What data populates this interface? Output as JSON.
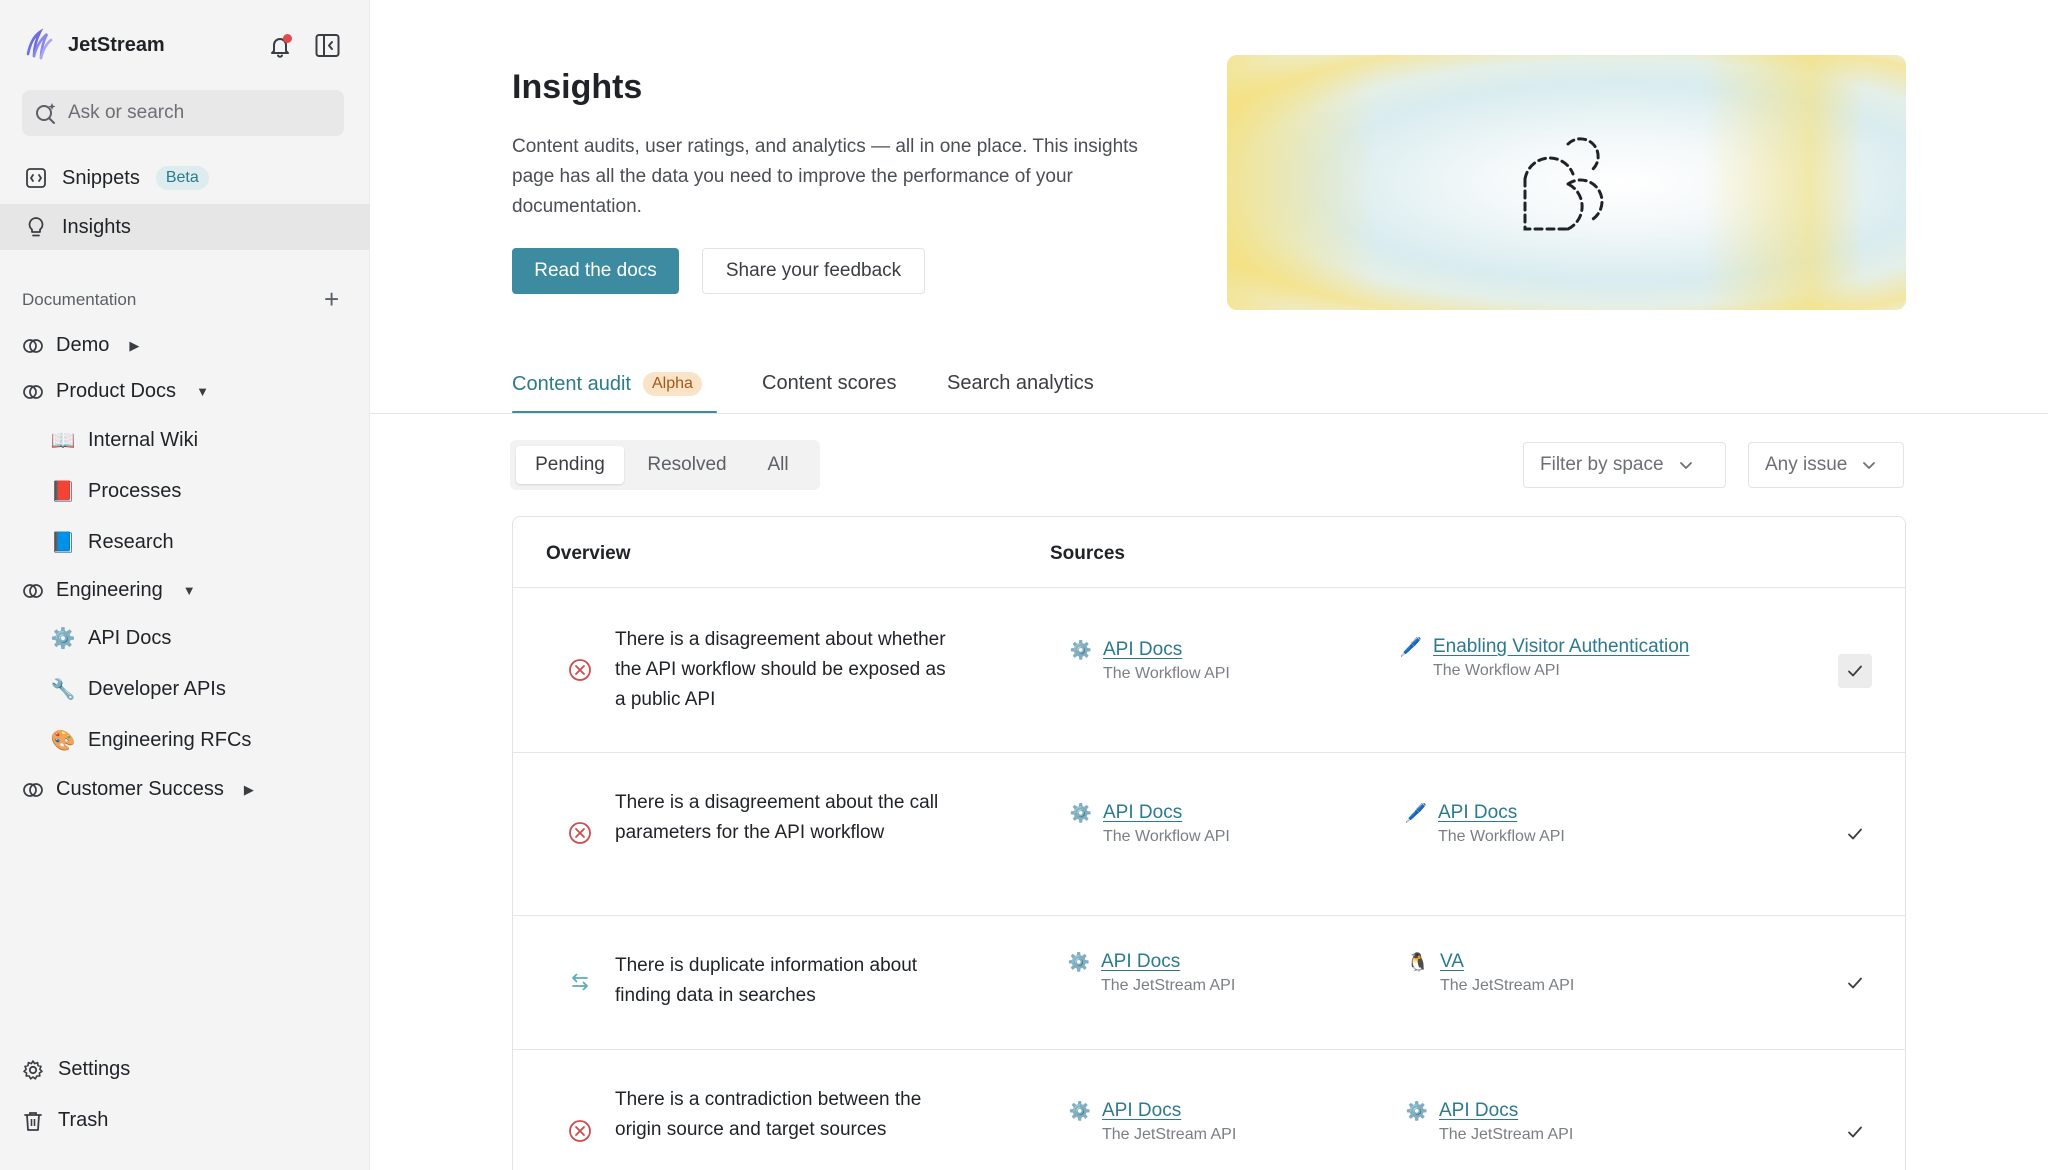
{
  "app": {
    "name": "JetStream"
  },
  "search": {
    "placeholder": "Ask or search"
  },
  "nav": {
    "snippets": "Snippets",
    "snippets_badge": "Beta",
    "insights": "Insights"
  },
  "documentation": {
    "label": "Documentation",
    "spaces": [
      {
        "name": "Demo",
        "expanded": false
      },
      {
        "name": "Product Docs",
        "expanded": true,
        "pages": [
          {
            "emoji": "📖",
            "name": "Internal Wiki"
          },
          {
            "emoji": "📕",
            "name": "Processes"
          },
          {
            "emoji": "📘",
            "name": "Research"
          }
        ]
      },
      {
        "name": "Engineering",
        "expanded": true,
        "pages": [
          {
            "emoji": "⚙️",
            "name": "API Docs"
          },
          {
            "emoji": "🔧",
            "name": "Developer APIs"
          },
          {
            "emoji": "🎨",
            "name": "Engineering RFCs"
          }
        ]
      },
      {
        "name": "Customer Success",
        "expanded": false
      }
    ]
  },
  "footer": {
    "settings": "Settings",
    "trash": "Trash"
  },
  "header": {
    "title": "Insights",
    "description": "Content audits, user ratings, and analytics — all in one place. This insights page has all the data you need to improve the performance of your documentation.",
    "primary_button": "Read the docs",
    "secondary_button": "Share your feedback"
  },
  "tabs": [
    {
      "label": "Content audit",
      "badge": "Alpha",
      "active": true
    },
    {
      "label": "Content scores",
      "active": false
    },
    {
      "label": "Search analytics",
      "active": false
    }
  ],
  "filters": {
    "segments": [
      "Pending",
      "Resolved",
      "All"
    ],
    "active_segment": "Pending",
    "space_filter": "Filter by space",
    "issue_filter": "Any issue"
  },
  "table": {
    "headers": {
      "overview": "Overview",
      "sources": "Sources"
    },
    "rows": [
      {
        "type": "disagreement",
        "text": "There is a disagreement about whether the API workflow should be exposed as a public API",
        "source1": {
          "emoji": "⚙️",
          "title": "API Docs",
          "subtitle": "The Workflow API"
        },
        "source2": {
          "emoji": "🖊️",
          "title": "Enabling Visitor Authentication",
          "subtitle": "The Workflow API"
        },
        "hovered": true
      },
      {
        "type": "disagreement",
        "text": "There is a disagreement about the call parameters for the API workflow",
        "source1": {
          "emoji": "⚙️",
          "title": "API Docs",
          "subtitle": "The Workflow API"
        },
        "source2": {
          "emoji": "🖊️",
          "title": "API Docs",
          "subtitle": "The Workflow API"
        },
        "hovered": false
      },
      {
        "type": "duplicate",
        "text": "There is duplicate information about finding data in searches",
        "source1": {
          "emoji": "⚙️",
          "title": "API Docs",
          "subtitle": "The JetStream API"
        },
        "source2": {
          "emoji": "🐧",
          "title": "VA",
          "subtitle": "The JetStream API"
        },
        "hovered": false
      },
      {
        "type": "contradiction",
        "text": "There is a contradiction between the origin source and target sources",
        "source1": {
          "emoji": "⚙️",
          "title": "API Docs",
          "subtitle": "The JetStream API"
        },
        "source2": {
          "emoji": "⚙️",
          "title": "API Docs",
          "subtitle": "The JetStream API"
        },
        "hovered": false
      }
    ]
  },
  "colors": {
    "accent": "#3c8ba1",
    "link": "#2b7a8d",
    "error": "#d24b4b",
    "duplicate": "#5aa9bd",
    "notification_dot": "#e5484d"
  }
}
